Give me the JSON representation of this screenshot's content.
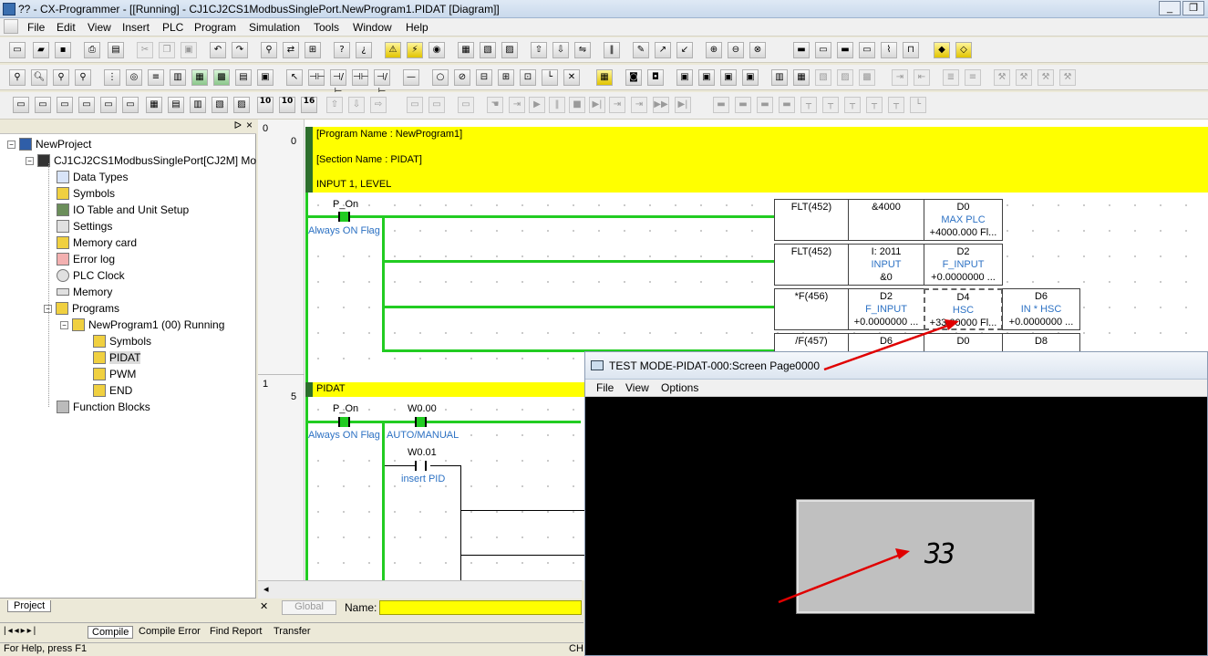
{
  "window": {
    "title": "?? - CX-Programmer - [[Running] - CJ1CJ2CS1ModbusSinglePort.NewProgram1.PIDAT [Diagram]]",
    "controls": [
      "_",
      "❐"
    ]
  },
  "menu": [
    "File",
    "Edit",
    "View",
    "Insert",
    "PLC",
    "Program",
    "Simulation",
    "Tools",
    "Window",
    "Help"
  ],
  "toolbar_zoom": [
    "10",
    "10",
    "16"
  ],
  "project_tree": {
    "items": [
      {
        "label": "NewProject",
        "icon": "project-icon"
      },
      {
        "label": "CJ1CJ2CS1ModbusSinglePort[CJ2M] Mo",
        "icon": "plc-icon"
      },
      {
        "label": "Data Types",
        "icon": "data-types-icon"
      },
      {
        "label": "Symbols",
        "icon": "symbols-icon"
      },
      {
        "label": "IO Table and Unit Setup",
        "icon": "io-table-icon"
      },
      {
        "label": "Settings",
        "icon": "settings-icon"
      },
      {
        "label": "Memory card",
        "icon": "memory-card-icon"
      },
      {
        "label": "Error log",
        "icon": "error-log-icon"
      },
      {
        "label": "PLC Clock",
        "icon": "clock-icon"
      },
      {
        "label": "Memory",
        "icon": "memory-icon"
      },
      {
        "label": "Programs",
        "icon": "programs-icon"
      },
      {
        "label": "NewProgram1 (00) Running",
        "icon": "program-icon"
      },
      {
        "label": "Symbols",
        "icon": "symbols-icon"
      },
      {
        "label": "PIDAT",
        "icon": "section-icon"
      },
      {
        "label": "PWM",
        "icon": "section-icon"
      },
      {
        "label": "END",
        "icon": "section-icon"
      },
      {
        "label": "Function Blocks",
        "icon": "function-blocks-icon"
      }
    ],
    "tab": "Project"
  },
  "diagram": {
    "rung0": {
      "number": "0",
      "step": "0"
    },
    "rung1": {
      "number": "1",
      "step": "5"
    },
    "program_name": "[Program Name : NewProgram1]",
    "section_name": "[Section Name : PIDAT]",
    "comment1": "INPUT 1, LEVEL",
    "comment2": "PIDAT",
    "contact1": {
      "name": "P_On",
      "comment": "Always ON Flag"
    },
    "contact2": {
      "name": "P_On",
      "comment": "Always ON Flag"
    },
    "contact3": {
      "name": "W0.00",
      "comment": "AUTO/MANUAL"
    },
    "contact4": {
      "name": "W0.01",
      "comment": "insert PID"
    },
    "fb_rows": [
      {
        "instr": "FLT(452)",
        "op1": "&4000",
        "op1c": "",
        "op1v": "",
        "op2": "D0",
        "op2c": "MAX PLC",
        "op2v": "+4000.000 Fl..."
      },
      {
        "instr": "FLT(452)",
        "op1": "I: 2011",
        "op1c": "INPUT",
        "op1v": "&0",
        "op2": "D2",
        "op2c": "F_INPUT",
        "op2v": "+0.0000000 ..."
      },
      {
        "instr": "*F(456)",
        "op1": "D2",
        "op1c": "F_INPUT",
        "op1v": "+0.0000000 ...",
        "op2": "D4",
        "op2c": "HSC",
        "op2v": "+33.00000 Fl...",
        "op3": "D6",
        "op3c": "IN * HSC",
        "op3v": "+0.0000000 ..."
      },
      {
        "instr": "/F(457)",
        "op1": "D6",
        "op2": "D0",
        "op3": "D8"
      }
    ]
  },
  "namebar": {
    "global_label": "Global",
    "name_label": "Name:"
  },
  "bottom_tabs": [
    "Compile",
    "Compile Error",
    "Find Report",
    "Transfer"
  ],
  "status": {
    "text": "For Help, press F1",
    "right": "CH"
  },
  "test_window": {
    "title": "TEST MODE-PIDAT-000:Screen Page0000",
    "menu": [
      "File",
      "View",
      "Options"
    ],
    "display_value": "33"
  }
}
